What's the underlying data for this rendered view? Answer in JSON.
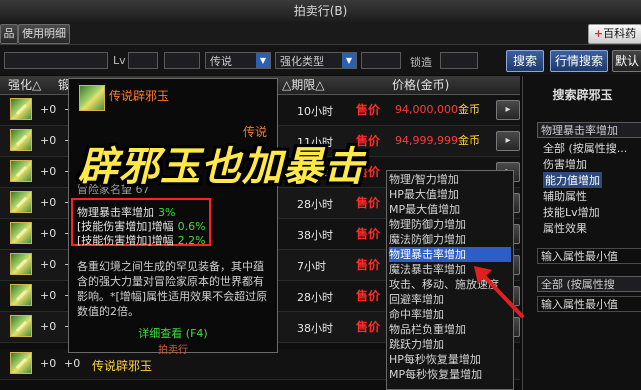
{
  "window": {
    "title": "拍卖行(B)"
  },
  "toolbar": {
    "tab1": "品",
    "tab2": "使用明细",
    "right_btn": "百科药",
    "right_btn_prefix": "+"
  },
  "search": {
    "lv_label": "Lv",
    "rarity": "传说",
    "type_label": "强化类型",
    "lock_label": "锁造",
    "default_label": "默认",
    "search_btn": "搜索",
    "market_btn": "行情搜索"
  },
  "table": {
    "headers": {
      "enhance": "强化△",
      "lock": "锻",
      "deadline": "△期限△",
      "price": "价格(金币)"
    },
    "rows": [
      {
        "plus": "+0",
        "zero": "+0",
        "time": "10小时",
        "sell": "售价",
        "price": "94,000,000",
        "unit": "金币"
      },
      {
        "plus": "+0",
        "zero": "+0",
        "time": "11小时",
        "sell": "售价",
        "price": "94,999,999",
        "unit": "金币"
      },
      {
        "plus": "+0",
        "zero": "+0",
        "time": "12小时",
        "sell": "售价",
        "price": "",
        "unit": ""
      },
      {
        "plus": "+0",
        "zero": "+0",
        "time": "28小时",
        "sell": "售价",
        "price": "",
        "unit": ""
      },
      {
        "plus": "+0",
        "zero": "+0",
        "time": "38小时",
        "sell": "售价",
        "price": "",
        "unit": ""
      },
      {
        "plus": "+0",
        "zero": "+0",
        "time": "7小时",
        "sell": "售价",
        "price": "",
        "unit": ""
      },
      {
        "plus": "+0",
        "zero": "+0",
        "time": "28小时",
        "sell": "售价",
        "price": "",
        "unit": ""
      },
      {
        "plus": "+0",
        "zero": "+0",
        "time": "38小时",
        "sell": "售价",
        "price": "",
        "unit": ""
      },
      {
        "plus": "+0",
        "zero": "+0",
        "time": "",
        "sell": "",
        "price": "",
        "unit": "",
        "name": "传说辟邪玉"
      }
    ]
  },
  "tooltip": {
    "name": "传说辟邪玉",
    "rarity": "传说",
    "fame": "冒险家名望 67",
    "stats": [
      {
        "label": "物理暴击率增加",
        "value": "3%"
      },
      {
        "label": "[技能伤害增加]增幅",
        "value": "0.6%"
      },
      {
        "label": "[技能伤害增加]增幅",
        "value": "2.2%"
      }
    ],
    "desc": "各重幻境之间生成的罕见装备，其中蕴含的强大力量对冒险家原本的世界都有影响。*[增幅]属性适用效果不会超过原数值的2倍。",
    "detail": "详细查看 (F4)",
    "auction": "拍卖行"
  },
  "banner": {
    "text": "辟邪玉也加暴击"
  },
  "right_panel": {
    "title": "搜索辟邪玉",
    "select_value": "物理暴击率增加",
    "tree": [
      "全部 (按属性搜...",
      "伤害增加",
      "能力值增加",
      "辅助属性",
      "技能Lv增加",
      "属性效果"
    ],
    "tree_selected_index": 2,
    "min_input_1": "输入属性最小值",
    "select2_value": "全部 (按属性搜",
    "min_input_2": "输入属性最小值"
  },
  "dropdown": {
    "options": [
      "物理/智力增加",
      "HP最大值增加",
      "MP最大值增加",
      "物理防御力增加",
      "魔法防御力增加",
      "物理暴击率增加",
      "魔法暴击率增加",
      "攻击、移动、施放速度",
      "回避率增加",
      "命中率增加",
      "物品栏负重增加",
      "跳跃力增加",
      "HP每秒恢复量增加",
      "MP每秒恢复量增加"
    ],
    "highlighted_index": 5
  },
  "colors": {
    "accent": "#2c5ec7",
    "sell_red": "#ff2a2a",
    "stat_green": "#3fdc3f",
    "banner_yellow": "#ffe94a",
    "box_red": "#ff2222"
  }
}
